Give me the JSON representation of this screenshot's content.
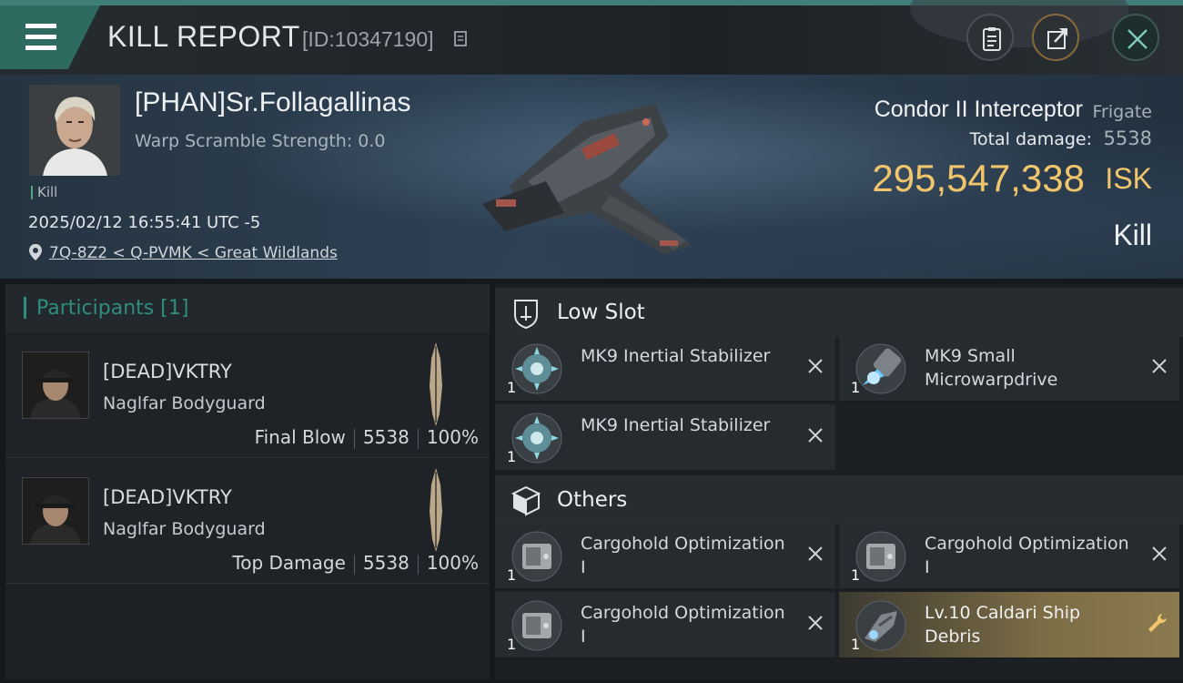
{
  "header": {
    "title": "KILL REPORT",
    "report_id": "[ID:10347190]",
    "buttons": [
      "menu-icon",
      "clipboard-icon",
      "share-icon",
      "close-icon"
    ]
  },
  "victim": {
    "name": "[PHAN]Sr.Follagallinas",
    "warp_scramble": "Warp Scramble Strength: 0.0",
    "tag": "Kill",
    "timestamp": "2025/02/12 16:55:41 UTC -5",
    "location": "7Q-8Z2 < Q-PVMK < Great Wildlands",
    "ship_name": "Condor II Interceptor",
    "ship_class": "Frigate",
    "total_damage_label": "Total damage:",
    "total_damage": "5538",
    "isk_value": "295,547,338",
    "isk_unit": "ISK",
    "outcome": "Kill"
  },
  "participants": {
    "title": "Participants",
    "count": "[1]",
    "items": [
      {
        "name": "[DEAD]VKTRY",
        "ship": "Naglfar Bodyguard",
        "role": "Final Blow",
        "damage": "5538",
        "percent": "100%"
      },
      {
        "name": "[DEAD]VKTRY",
        "ship": "Naglfar Bodyguard",
        "role": "Top Damage",
        "damage": "5538",
        "percent": "100%"
      }
    ]
  },
  "fittings": {
    "low_slot": {
      "title": "Low Slot",
      "items": [
        {
          "name": "MK9 Inertial Stabilizer",
          "qty": "1"
        },
        {
          "name": "MK9 Small Microwarpdrive",
          "qty": "1"
        },
        {
          "name": "MK9 Inertial Stabilizer",
          "qty": "1"
        }
      ]
    },
    "others": {
      "title": "Others",
      "items": [
        {
          "name": "Cargohold Optimization I",
          "qty": "1"
        },
        {
          "name": "Cargohold Optimization I",
          "qty": "1"
        },
        {
          "name": "Cargohold Optimization I",
          "qty": "1"
        },
        {
          "name": "Lv.10 Caldari Ship Debris",
          "qty": "1"
        }
      ]
    }
  },
  "colors": {
    "accent": "#2f8d80",
    "isk": "#f1c56b",
    "highlight": "#8c7a4f"
  }
}
